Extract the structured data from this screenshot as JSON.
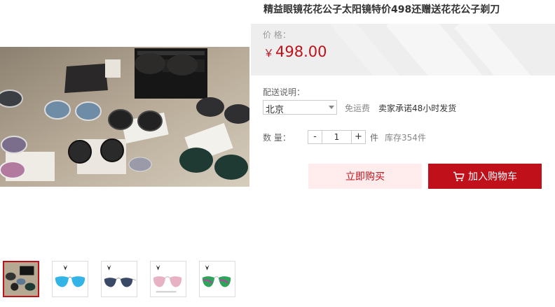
{
  "product": {
    "title": "精益眼镜花花公子太阳镜特价498还赠送花花公子剃刀"
  },
  "price": {
    "label": "价      格：",
    "currency": "￥",
    "value": "498.00",
    "accent_color": "#c0111b"
  },
  "shipping": {
    "label": "配送说明：",
    "region": "北京",
    "free_shipping": "免运费",
    "promise": "卖家承诺48小时发货"
  },
  "quantity": {
    "label": "数      量：",
    "minus": "-",
    "value": "1",
    "plus": "+",
    "unit": "件",
    "stock": "库存354件"
  },
  "actions": {
    "buy_now": "立即购买",
    "add_to_cart": "加入购物车",
    "cart_icon": "shopping-cart-icon"
  },
  "gallery": {
    "thumbnails": [
      {
        "icon": "display-case-photo"
      },
      {
        "icon": "blue-mirror-aviator-sunglasses"
      },
      {
        "icon": "dark-aviator-sunglasses"
      },
      {
        "icon": "pink-aviator-sunglasses"
      },
      {
        "icon": "green-mirror-sunglasses"
      }
    ]
  }
}
